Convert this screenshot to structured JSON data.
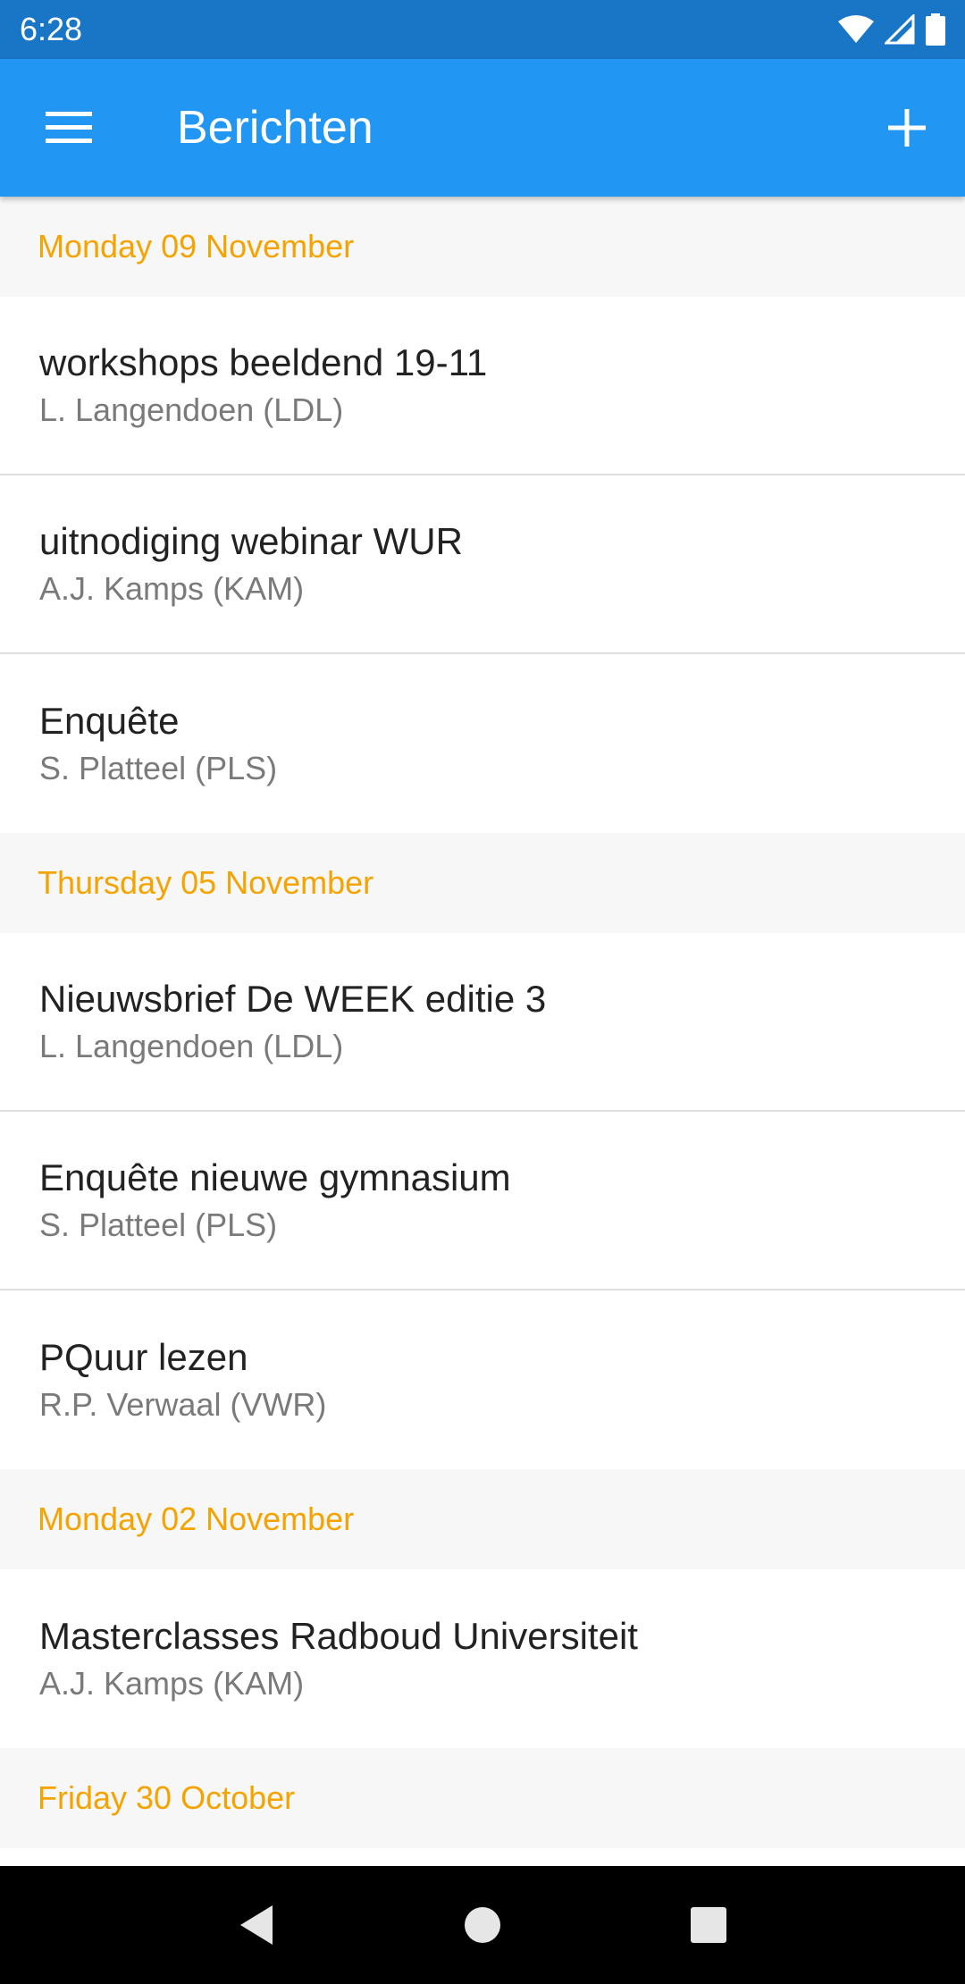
{
  "status_bar": {
    "time": "6:28",
    "icons": [
      "wifi-icon",
      "signal-icon",
      "battery-icon"
    ]
  },
  "app_bar": {
    "title": "Berichten",
    "menu_icon": "menu-icon",
    "add_icon": "plus-icon"
  },
  "colors": {
    "status_bar": "#1976c6",
    "app_bar": "#2196f3",
    "section_header_text": "#f5a300",
    "section_header_bg": "#f7f7f7"
  },
  "sections": [
    {
      "date": "Monday 09 November",
      "items": [
        {
          "title": "workshops beeldend 19-11",
          "author": "L. Langendoen (LDL)"
        },
        {
          "title": "uitnodiging webinar WUR",
          "author": "A.J. Kamps (KAM)"
        },
        {
          "title": "Enquête",
          "author": "S. Platteel (PLS)"
        }
      ]
    },
    {
      "date": "Thursday 05 November",
      "items": [
        {
          "title": "Nieuwsbrief De WEEK editie 3",
          "author": "L. Langendoen (LDL)"
        },
        {
          "title": "Enquête nieuwe gymnasium",
          "author": "S. Platteel (PLS)"
        },
        {
          "title": "PQuur lezen",
          "author": "R.P. Verwaal (VWR)"
        }
      ]
    },
    {
      "date": "Monday 02 November",
      "items": [
        {
          "title": "Masterclasses Radboud Universiteit",
          "author": "A.J. Kamps (KAM)"
        }
      ]
    },
    {
      "date": "Friday 30 October",
      "items": []
    }
  ],
  "nav_bar": {
    "icons": [
      "back-icon",
      "home-icon",
      "recents-icon"
    ]
  }
}
